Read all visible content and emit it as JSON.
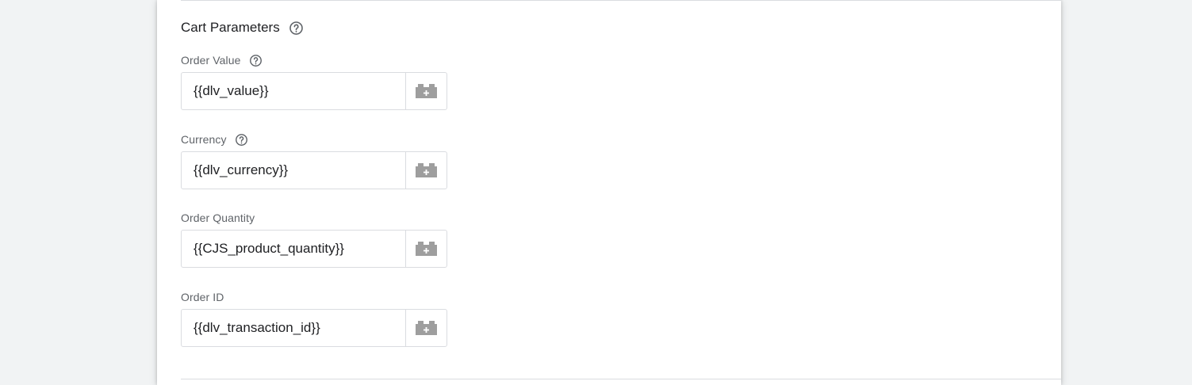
{
  "section": {
    "title": "Cart Parameters",
    "help_icon": "help-circle-icon"
  },
  "fields": [
    {
      "label": "Order Value",
      "value": "{{dlv_value}}",
      "has_help": true
    },
    {
      "label": "Currency",
      "value": "{{dlv_currency}}",
      "has_help": true
    },
    {
      "label": "Order Quantity",
      "value": "{{CJS_product_quantity}}",
      "has_help": false
    },
    {
      "label": "Order ID",
      "value": "{{dlv_transaction_id}}",
      "has_help": false
    }
  ],
  "icons": {
    "variable_picker": "add-variable-brick-icon",
    "help": "help-circle-icon"
  },
  "colors": {
    "page_background": "#f1f3f4",
    "card_background": "#ffffff",
    "border": "#dadce0",
    "label_text": "#5f6368",
    "value_text": "#202124",
    "icon_gray": "#9e9e9e"
  }
}
